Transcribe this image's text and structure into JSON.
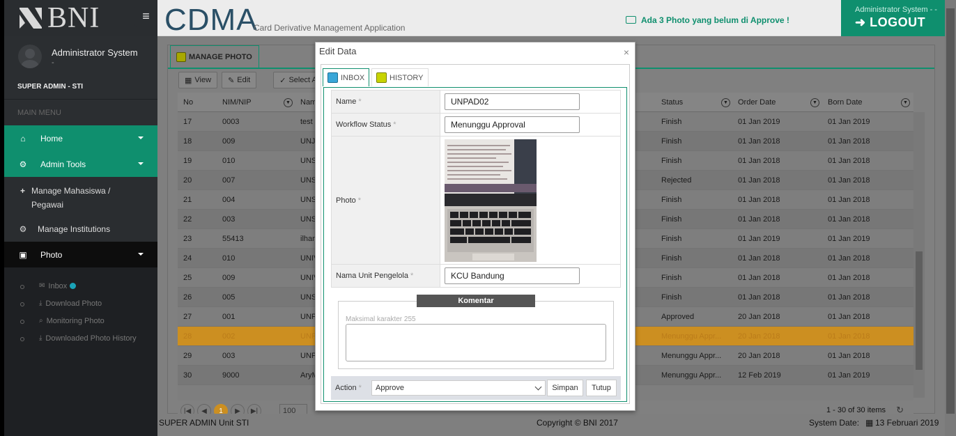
{
  "brand": {
    "logo_text": "BNI"
  },
  "sidebar": {
    "user_name": "Administrator System",
    "user_sub": "-",
    "role": "SUPER ADMIN - STI",
    "main_menu_label": "MAIN MENU",
    "items": [
      {
        "label": "Home",
        "icon": "home-icon"
      },
      {
        "label": "Admin Tools",
        "icon": "gear-icon"
      },
      {
        "label": "Manage Mahasiswa / Pegawai",
        "icon": "plus-icon"
      },
      {
        "label": "Manage Institutions",
        "icon": "gear-icon"
      },
      {
        "label": "Photo",
        "icon": "image-icon"
      }
    ],
    "photo_sub": [
      {
        "label": "Inbox",
        "icon": "envelope-icon"
      },
      {
        "label": "Download Photo",
        "icon": "download-icon"
      },
      {
        "label": "Monitoring Photo",
        "icon": "search-icon"
      },
      {
        "label": "Downloaded Photo History",
        "icon": "download-icon"
      }
    ]
  },
  "header": {
    "app_title": "CDMA",
    "app_subtitle": "Card Derivative Management Application",
    "notification": "Ada 3 Photo yang belum di Approve !",
    "logout_user": "Administrator System - -",
    "logout_label": "LOGOUT"
  },
  "panel": {
    "tab": "MANAGE PHOTO",
    "toolbar": {
      "view": "View",
      "edit": "Edit",
      "select_all": "Select A"
    },
    "columns": {
      "no": "No",
      "nim": "NIM/NIP",
      "name": "Nam",
      "status": "Status",
      "order_date": "Order Date",
      "born_date": "Born Date"
    },
    "rows": [
      {
        "no": "17",
        "nim": "0003",
        "name": "test",
        "status": "Finish",
        "order": "01 Jan 2019",
        "born": "01 Jan 2019"
      },
      {
        "no": "18",
        "nim": "009",
        "name": "UNJA",
        "status": "Finish",
        "order": "01 Jan 2018",
        "born": "01 Jan 2018"
      },
      {
        "no": "19",
        "nim": "010",
        "name": "UNS",
        "status": "Finish",
        "order": "01 Jan 2018",
        "born": "01 Jan 2018"
      },
      {
        "no": "20",
        "nim": "007",
        "name": "UNS",
        "status": "Rejected",
        "order": "01 Jan 2018",
        "born": "01 Jan 2018"
      },
      {
        "no": "21",
        "nim": "004",
        "name": "UNS",
        "status": "Finish",
        "order": "01 Jan 2018",
        "born": "01 Jan 2018"
      },
      {
        "no": "22",
        "nim": "003",
        "name": "UNS",
        "status": "Finish",
        "order": "01 Jan 2018",
        "born": "01 Jan 2018"
      },
      {
        "no": "23",
        "nim": "55413",
        "name": "ilhan",
        "status": "Finish",
        "order": "01 Jan 2019",
        "born": "01 Jan 2019"
      },
      {
        "no": "24",
        "nim": "010",
        "name": "UNIV",
        "status": "Finish",
        "order": "01 Jan 2018",
        "born": "01 Jan 2018"
      },
      {
        "no": "25",
        "nim": "009",
        "name": "UNIV",
        "status": "Finish",
        "order": "01 Jan 2018",
        "born": "01 Jan 2018"
      },
      {
        "no": "26",
        "nim": "005",
        "name": "UNS",
        "status": "Finish",
        "order": "01 Jan 2018",
        "born": "01 Jan 2018"
      },
      {
        "no": "27",
        "nim": "001",
        "name": "UNP",
        "status": "Approved",
        "order": "20 Jan 2018",
        "born": "01 Jan 2018"
      },
      {
        "no": "28",
        "nim": "002",
        "name": "UNP",
        "status": "Menunggu Appr...",
        "order": "20 Jan 2018",
        "born": "01 Jan 2018"
      },
      {
        "no": "29",
        "nim": "003",
        "name": "UNP",
        "status": "Menunggu Appr...",
        "order": "20 Jan 2018",
        "born": "01 Jan 2018"
      },
      {
        "no": "30",
        "nim": "9000",
        "name": "AryM",
        "status": "Menunggu Appr...",
        "order": "12 Feb 2019",
        "born": "01 Jan 2019"
      }
    ],
    "pager": {
      "current": "1",
      "page_size": "100",
      "items": "1 - 30 of 30 items"
    }
  },
  "footer": {
    "left": "SUPER ADMIN Unit STI",
    "center": "Copyright © BNI 2017",
    "right": "System Date:",
    "date": "13 Februari 2019"
  },
  "modal": {
    "title": "Edit Data",
    "tabs": [
      "INBOX",
      "HISTORY"
    ],
    "fields": {
      "name_label": "Name",
      "name_value": "UNPAD02",
      "workflow_label": "Workflow Status",
      "workflow_value": "Menunggu Approval",
      "photo_label": "Photo",
      "unit_label": "Nama Unit Pengelola",
      "unit_value": "KCU Bandung",
      "required_mark": "*"
    },
    "komentar": {
      "title": "Komentar",
      "hint": "Maksimal karakter 255"
    },
    "action": {
      "label": "Action",
      "selected": "Approve",
      "save": "Simpan",
      "close": "Tutup"
    }
  }
}
